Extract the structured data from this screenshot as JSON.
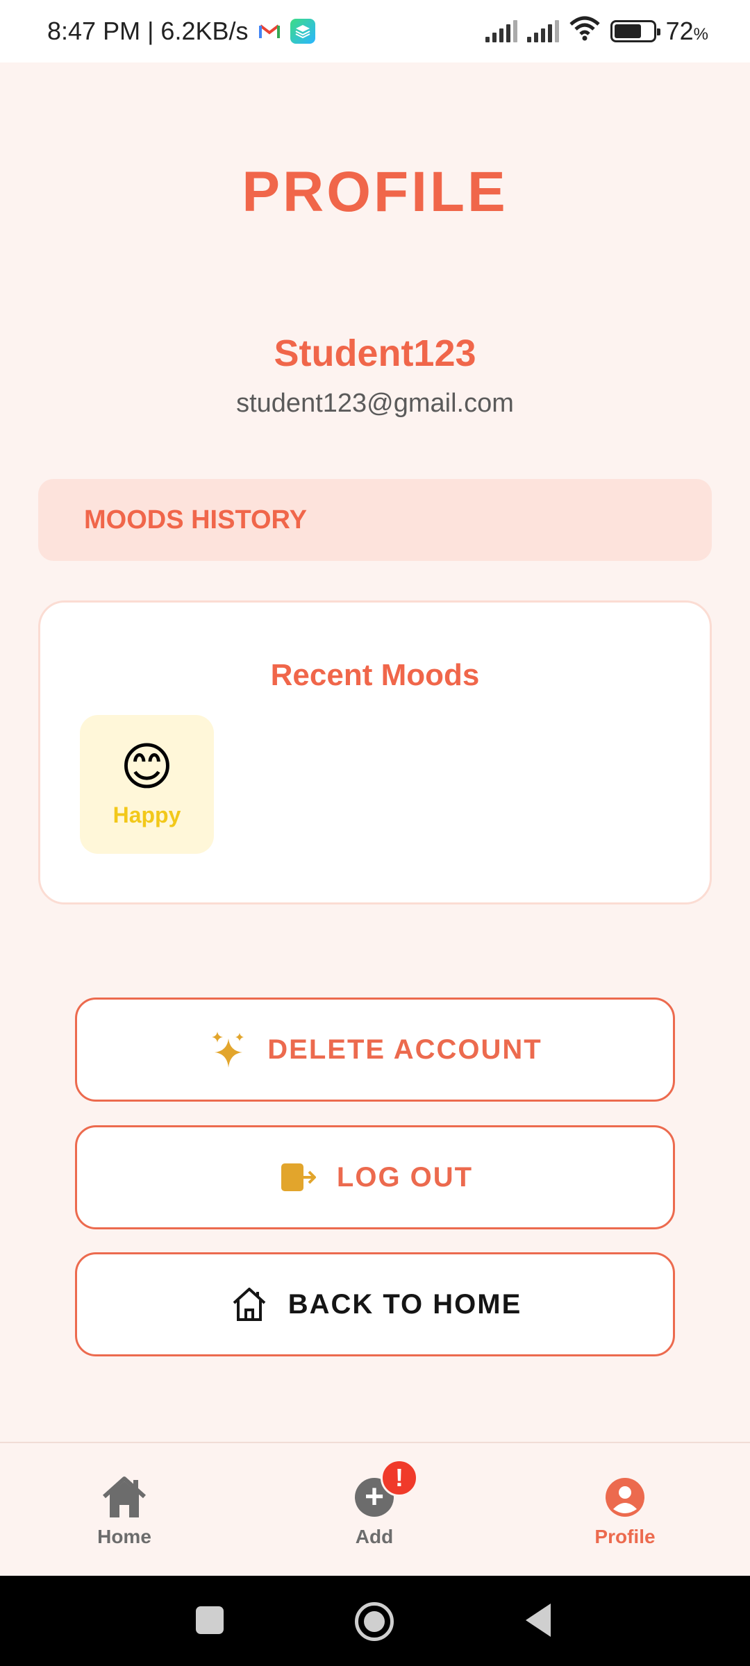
{
  "status_bar": {
    "time_speed": "8:47 PM | 6.2KB/s",
    "battery_percent": "72",
    "battery_unit": "%",
    "battery_level": 0.72,
    "icons": [
      "gmail-icon",
      "layers-app-icon",
      "signal-icon",
      "signal-icon",
      "wifi-icon",
      "battery-icon"
    ]
  },
  "header": {
    "title": "PROFILE"
  },
  "profile": {
    "username": "Student123",
    "email": "student123@gmail.com"
  },
  "moods_history": {
    "label": "MOODS HISTORY"
  },
  "recent_moods": {
    "title": "Recent Moods",
    "items": [
      {
        "emoji": "😊",
        "label": "Happy",
        "color": "#f2c81a"
      }
    ]
  },
  "actions": {
    "delete_account": "DELETE ACCOUNT",
    "log_out": "LOG OUT",
    "back_to_home": "BACK TO HOME"
  },
  "bottom_nav": {
    "home": "Home",
    "add": "Add",
    "add_badge": "!",
    "profile": "Profile",
    "active": "Profile"
  },
  "colors": {
    "accent": "#f0664a",
    "background": "#fdf3f0",
    "moods_header_bg": "#fde3dc",
    "mood_tile_bg": "#fff7d9",
    "badge": "#f03a2a"
  }
}
